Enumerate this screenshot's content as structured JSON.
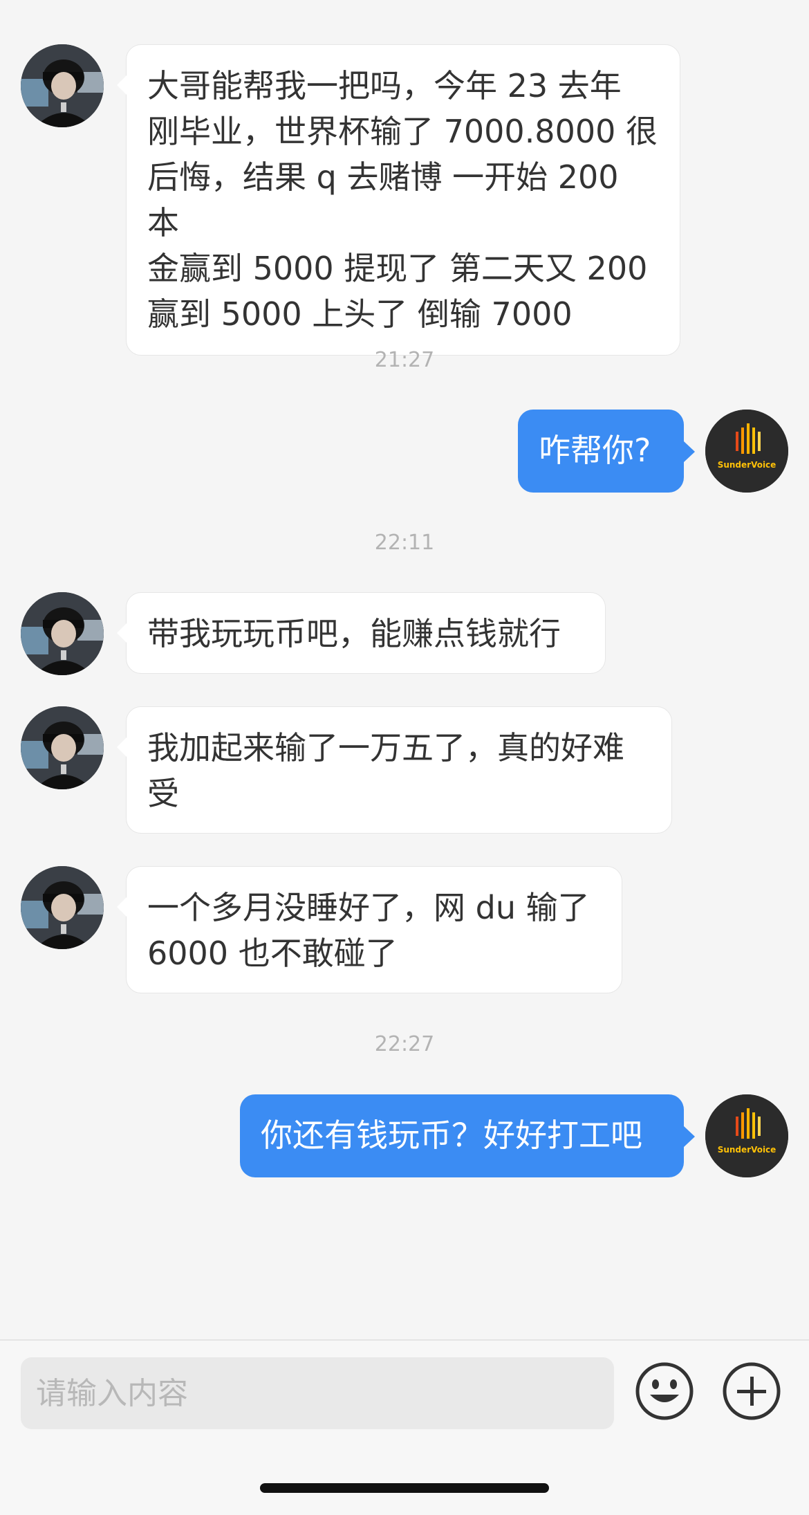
{
  "messages": [
    {
      "type": "peer",
      "text": "大哥能帮我一把吗，今年 23 去年\n刚毕业，世界杯输了 7000.8000 很\n后悔，结果 q 去赌博 一开始 200 本\n金赢到 5000 提现了 第二天又 200\n赢到 5000 上头了 倒输 7000"
    },
    {
      "type": "time",
      "text": "21:27"
    },
    {
      "type": "self",
      "text": "咋帮你?"
    },
    {
      "type": "time",
      "text": "22:11"
    },
    {
      "type": "peer",
      "text": "带我玩玩币吧，能赚点钱就行"
    },
    {
      "type": "peer",
      "text": "我加起来输了一万五了，真的好难\n受"
    },
    {
      "type": "peer",
      "text": "一个多月没睡好了，网 du 输了\n6000 也不敢碰了"
    },
    {
      "type": "time",
      "text": "22:27"
    },
    {
      "type": "self",
      "text": "你还有钱玩币？好好打工吧"
    }
  ],
  "self_avatar_label": "SunderVoice",
  "input": {
    "placeholder": "请输入内容",
    "value": ""
  },
  "colors": {
    "accent": "#3b8cf3",
    "background": "#f5f5f5",
    "bubble_in": "#ffffff"
  },
  "icons": {
    "emoji": "smiley-face-icon",
    "add": "plus-circle-icon"
  }
}
